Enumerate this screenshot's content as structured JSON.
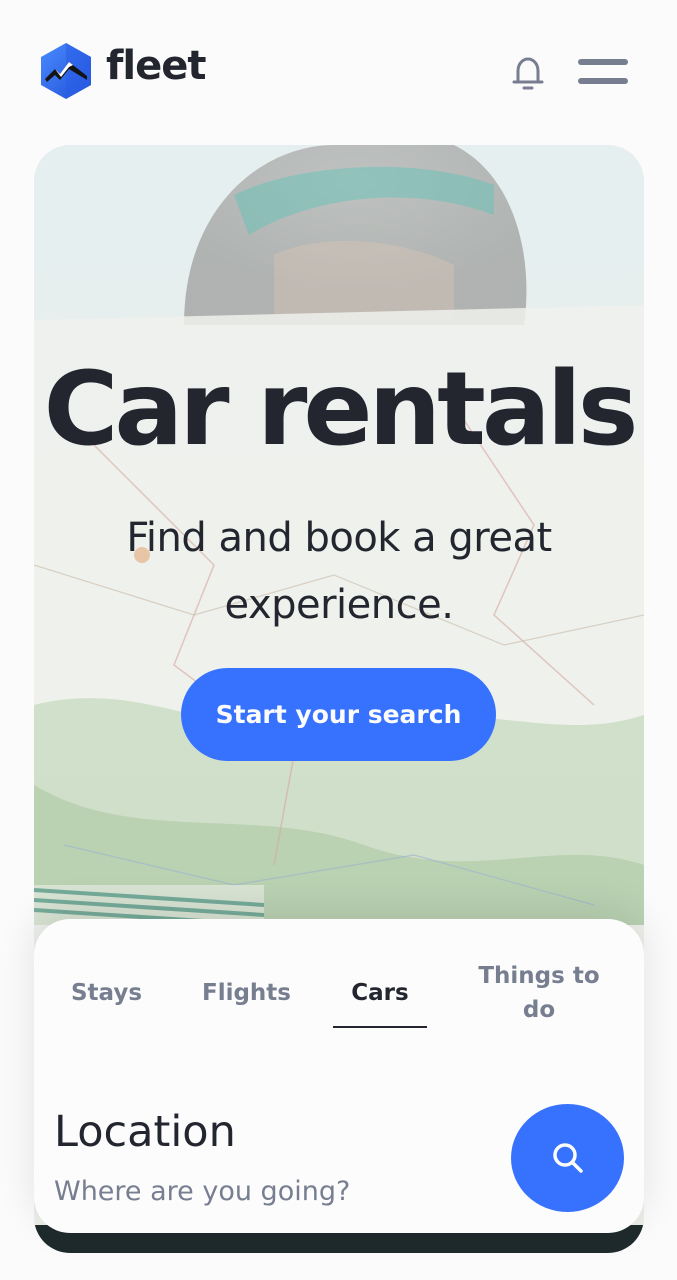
{
  "app": {
    "name": "fleet",
    "accent": "#3772ff",
    "text_dark": "#23262f",
    "text_muted": "#777e90"
  },
  "header": {
    "logo_icon": "hexagon-mountain-logo",
    "bell_icon": "bell-icon",
    "menu_icon": "hamburger-menu-icon"
  },
  "hero": {
    "title": "Car rentals",
    "subtitle": "Find and book a great experience.",
    "cta_label": "Start your search"
  },
  "search_card": {
    "tabs": [
      {
        "label": "Stays",
        "active": false
      },
      {
        "label": "Flights",
        "active": false
      },
      {
        "label": "Cars",
        "active": true
      },
      {
        "label": "Things to do",
        "active": false
      }
    ],
    "location_label": "Location",
    "location_placeholder": "Where are you going?",
    "search_icon": "search-icon"
  }
}
